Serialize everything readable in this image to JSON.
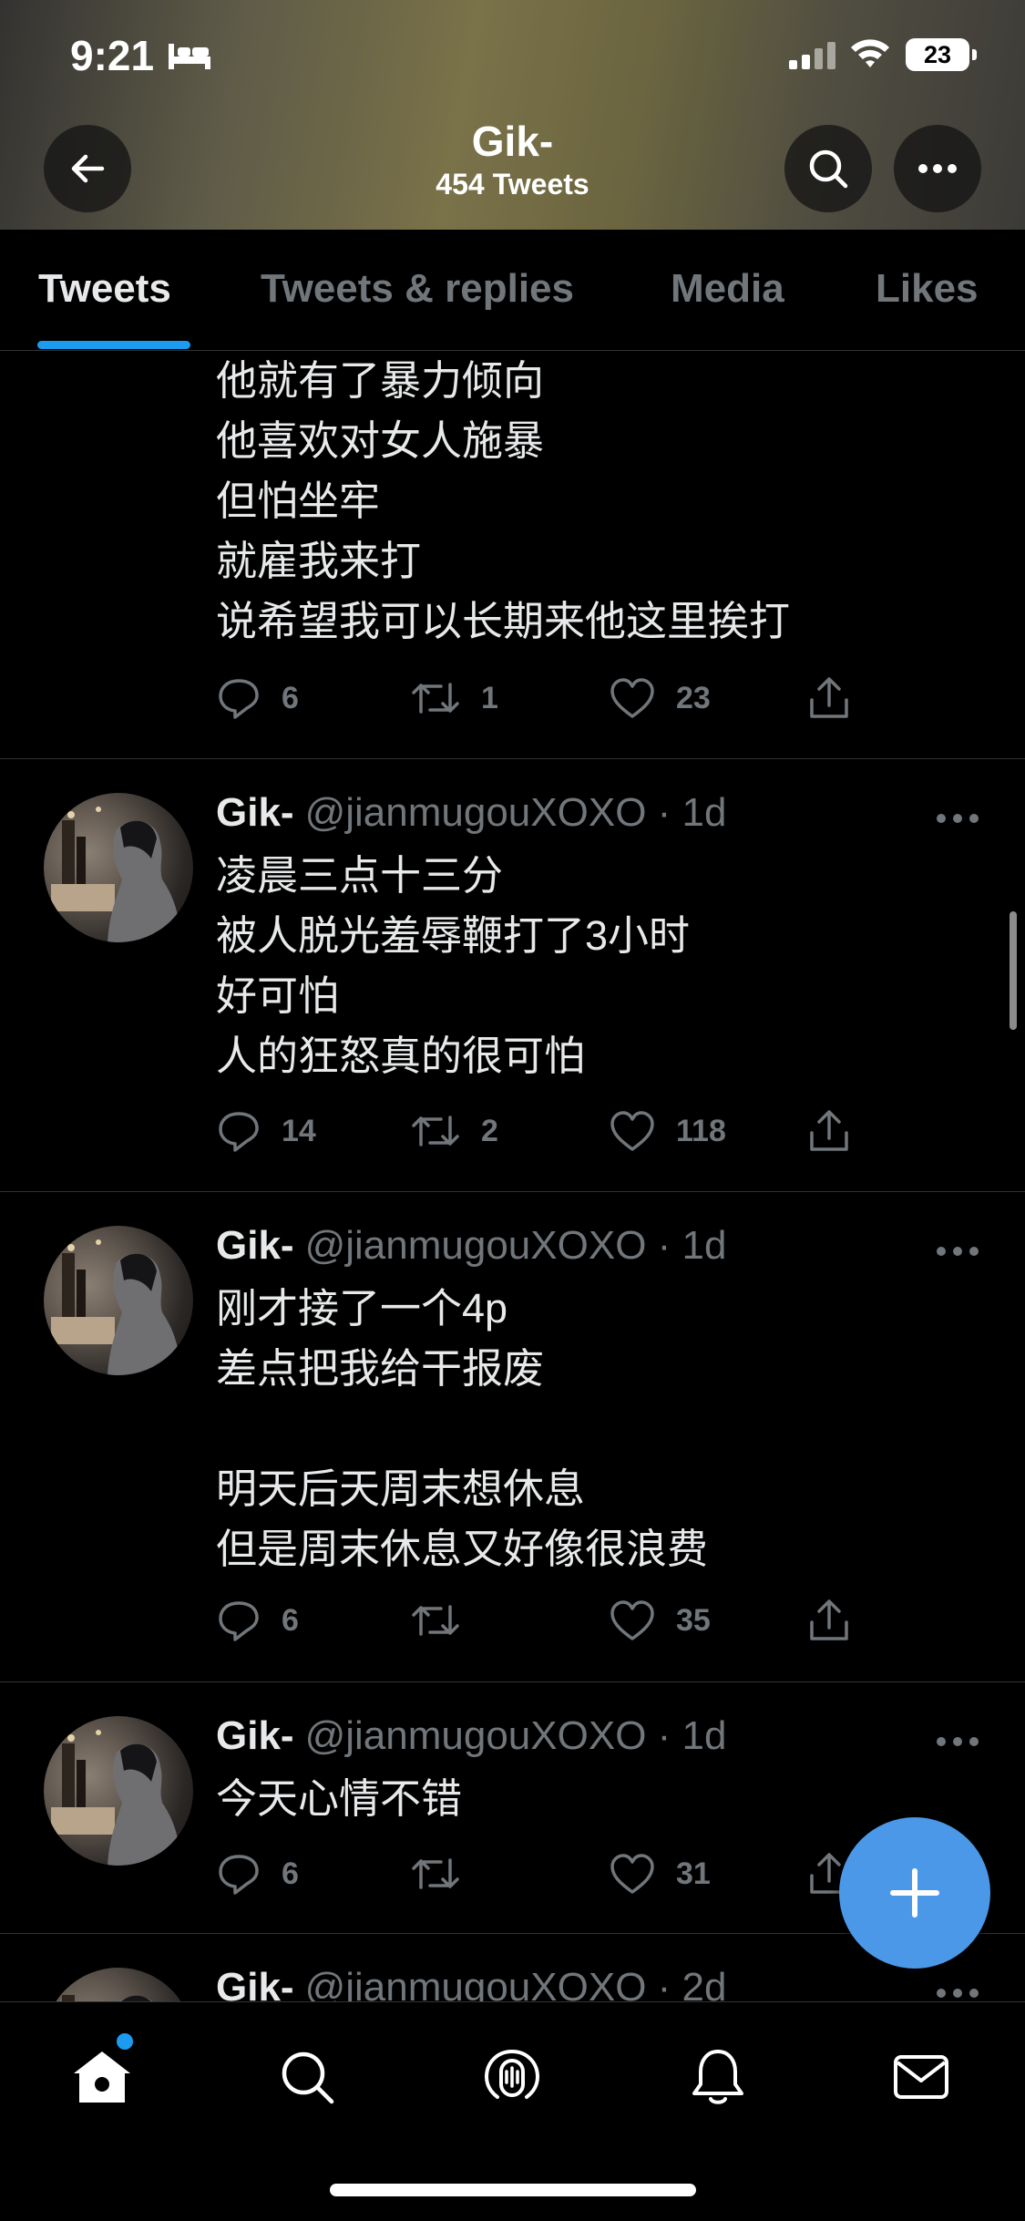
{
  "status_bar": {
    "time": "9:21",
    "battery": "23"
  },
  "header": {
    "title": "Gik-",
    "subtitle": "454 Tweets"
  },
  "tabs": [
    {
      "label": "Tweets",
      "active": true
    },
    {
      "label": "Tweets & replies",
      "active": false
    },
    {
      "label": "Media",
      "active": false
    },
    {
      "label": "Likes",
      "active": false
    }
  ],
  "tweets": [
    {
      "lines": [
        "他就有了暴力倾向",
        "他喜欢对女人施暴",
        "但怕坐牢",
        "就雇我来打",
        "说希望我可以长期来他这里挨打"
      ],
      "replies": "6",
      "retweets": "1",
      "likes": "23"
    },
    {
      "name": "Gik-",
      "handle": "@jianmugouXOXO · 1d",
      "lines": [
        "凌晨三点十三分",
        "被人脱光羞辱鞭打了3小时",
        "好可怕",
        "人的狂怒真的很可怕"
      ],
      "replies": "14",
      "retweets": "2",
      "likes": "118"
    },
    {
      "name": "Gik-",
      "handle": "@jianmugouXOXO · 1d",
      "lines": [
        "刚才接了一个4p",
        "差点把我给干报废",
        "",
        "明天后天周末想休息",
        "但是周末休息又好像很浪费"
      ],
      "replies": "6",
      "retweets": "",
      "likes": "35"
    },
    {
      "name": "Gik-",
      "handle": "@jianmugouXOXO · 1d",
      "lines": [
        "今天心情不错"
      ],
      "replies": "6",
      "retweets": "",
      "likes": "31"
    },
    {
      "name": "Gik-",
      "handle": "@jianmugouXOXO · 2d"
    }
  ],
  "colors": {
    "accent": "#1d9bf0",
    "fab": "#4b98e8",
    "muted": "#71767b"
  }
}
